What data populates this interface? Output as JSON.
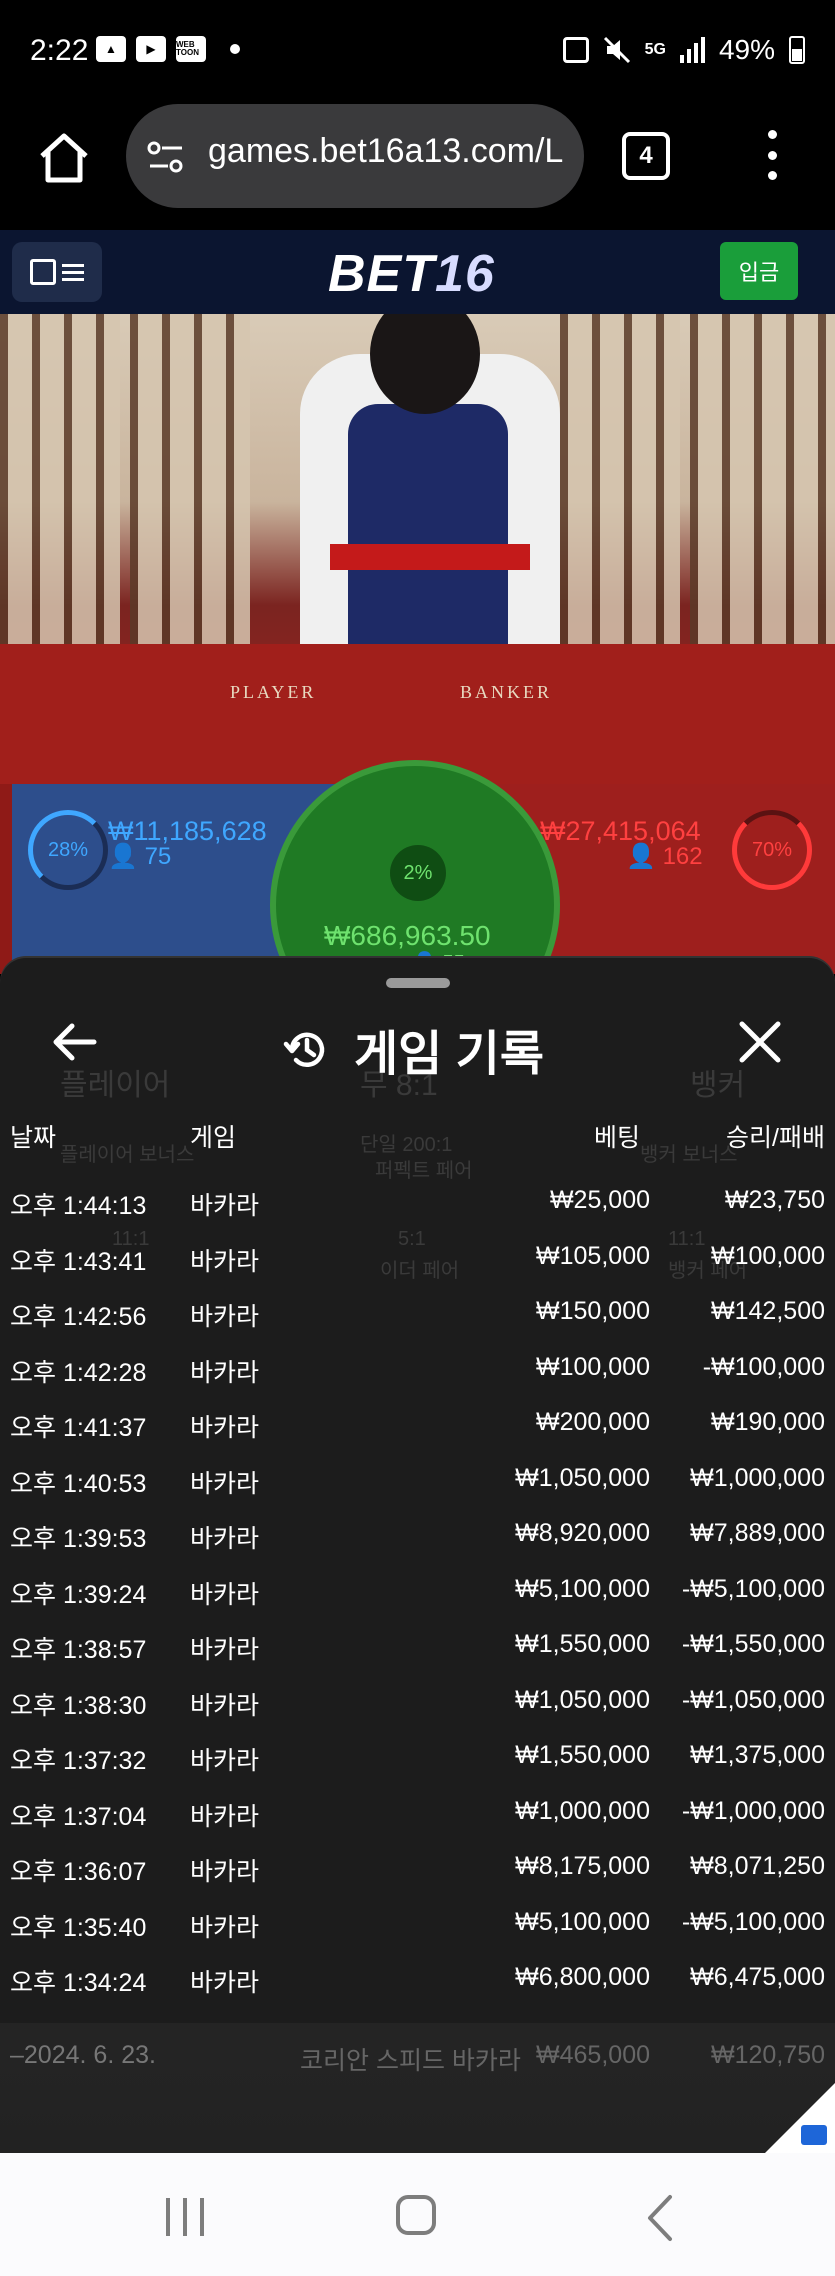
{
  "status_bar": {
    "time": "2:22",
    "battery": "49%",
    "icons": [
      "gallery-icon",
      "youtube-icon",
      "webtoon-icon",
      "dot-icon",
      "usb-icon",
      "mute-icon",
      "5g-icon",
      "signal-icon",
      "battery-icon"
    ],
    "webtoon_label": "WEB TOON",
    "network_label": "5G"
  },
  "browser": {
    "url": "games.bet16a13.com/L",
    "tab_count": "4"
  },
  "site": {
    "logo_bet": "BET",
    "logo_num": "16",
    "deposit_label": "입금",
    "accent_green": "#1a9e3a"
  },
  "scene": {
    "player_label": "PLAYER",
    "banker_label": "BANKER"
  },
  "betting": {
    "player_pct": "28%",
    "player_amount": "₩11,185,628",
    "player_count": "75",
    "banker_pct": "70%",
    "banker_amount": "₩27,415,064",
    "banker_count": "162",
    "tie_pct": "2%",
    "tie_amount": "₩686,963.50",
    "tie_count": "55"
  },
  "background_board": {
    "player": "플레이어",
    "tie": "무 8:1",
    "banker": "뱅커",
    "player_bonus": "플레이어 보너스",
    "perfect_pair": "퍼펙트 페어",
    "perfect_odds": "단일 200:1",
    "banker_bonus": "뱅커 보너스",
    "either_pair": "이더 페어",
    "either_odds": "5:1",
    "player_pair_odds": "11:1",
    "banker_pair": "뱅커 페어",
    "banker_pair_odds": "11:1"
  },
  "history": {
    "title": "게임 기록",
    "columns": {
      "date": "날짜",
      "game": "게임",
      "bet": "베팅",
      "result": "승리/패배"
    },
    "rows": [
      {
        "date": "오후 1:44:13",
        "game": "바카라",
        "bet": "₩25,000",
        "result": "₩23,750"
      },
      {
        "date": "오후 1:43:41",
        "game": "바카라",
        "bet": "₩105,000",
        "result": "₩100,000"
      },
      {
        "date": "오후 1:42:56",
        "game": "바카라",
        "bet": "₩150,000",
        "result": "₩142,500"
      },
      {
        "date": "오후 1:42:28",
        "game": "바카라",
        "bet": "₩100,000",
        "result": "-₩100,000"
      },
      {
        "date": "오후 1:41:37",
        "game": "바카라",
        "bet": "₩200,000",
        "result": "₩190,000"
      },
      {
        "date": "오후 1:40:53",
        "game": "바카라",
        "bet": "₩1,050,000",
        "result": "₩1,000,000"
      },
      {
        "date": "오후 1:39:53",
        "game": "바카라",
        "bet": "₩8,920,000",
        "result": "₩7,889,000"
      },
      {
        "date": "오후 1:39:24",
        "game": "바카라",
        "bet": "₩5,100,000",
        "result": "-₩5,100,000"
      },
      {
        "date": "오후 1:38:57",
        "game": "바카라",
        "bet": "₩1,550,000",
        "result": "-₩1,550,000"
      },
      {
        "date": "오후 1:38:30",
        "game": "바카라",
        "bet": "₩1,050,000",
        "result": "-₩1,050,000"
      },
      {
        "date": "오후 1:37:32",
        "game": "바카라",
        "bet": "₩1,550,000",
        "result": "₩1,375,000"
      },
      {
        "date": "오후 1:37:04",
        "game": "바카라",
        "bet": "₩1,000,000",
        "result": "-₩1,000,000"
      },
      {
        "date": "오후 1:36:07",
        "game": "바카라",
        "bet": "₩8,175,000",
        "result": "₩8,071,250"
      },
      {
        "date": "오후 1:35:40",
        "game": "바카라",
        "bet": "₩5,100,000",
        "result": "-₩5,100,000"
      },
      {
        "date": "오후 1:34:24",
        "game": "바카라",
        "bet": "₩6,800,000",
        "result": "₩6,475,000"
      }
    ],
    "partial_row": {
      "date": "–2024. 6. 23.",
      "game": "코리안 스피드 바카라",
      "bet": "₩465,000",
      "result": "₩120,750"
    }
  }
}
